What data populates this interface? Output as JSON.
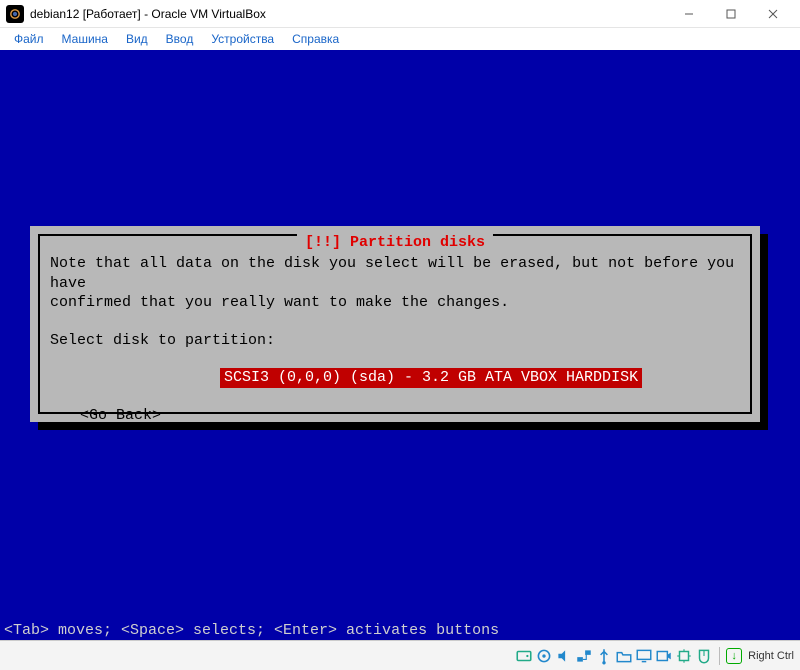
{
  "window": {
    "title": "debian12 [Работает] - Oracle VM VirtualBox"
  },
  "menu": {
    "file": "Файл",
    "machine": "Машина",
    "view": "Вид",
    "input": "Ввод",
    "devices": "Устройства",
    "help": "Справка"
  },
  "dialog": {
    "title": "[!!] Partition disks",
    "note_line1": "Note that all data on the disk you select will be erased, but not before you have",
    "note_line2": "confirmed that you really want to make the changes.",
    "prompt": "Select disk to partition:",
    "disk_option": "SCSI3 (0,0,0) (sda) - 3.2 GB ATA VBOX HARDDISK",
    "go_back": "<Go Back>"
  },
  "hint": "<Tab> moves; <Space> selects; <Enter> activates buttons",
  "statusbar": {
    "host_key": "Right Ctrl"
  }
}
